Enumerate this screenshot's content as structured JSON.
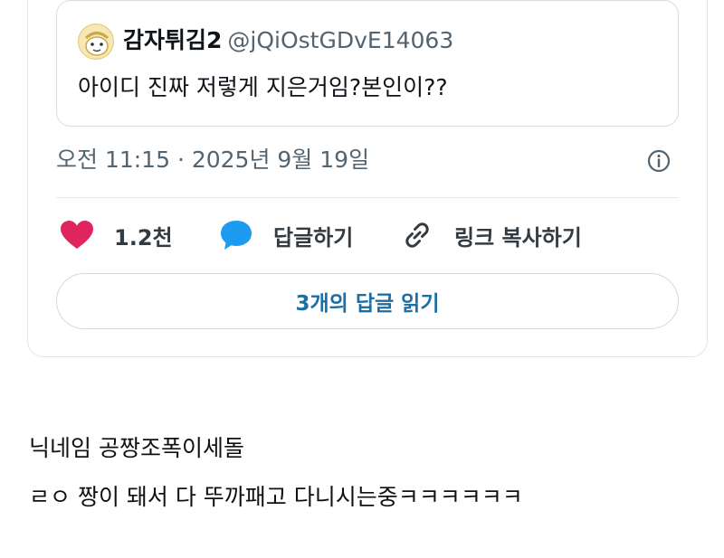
{
  "quoted_tweet": {
    "author_name": "감자튀김2",
    "author_handle": "@jQiOstGDvE14063",
    "text": "아이디 진짜 저렇게 지은거임?본인이??"
  },
  "tweet": {
    "timestamp": "오전 11:15 · 2025년 9월 19일"
  },
  "actions": {
    "like_count": "1.2천",
    "reply_label": "답글하기",
    "copy_link_label": "링크 복사하기"
  },
  "read_replies_label": "3개의 답글 읽기",
  "caption": {
    "line1": "닉네임 공짱조폭이세돌",
    "line2": "ㄹㅇ 짱이 돼서 다 뚜까패고 다니시는중ㅋㅋㅋㅋㅋㅋ"
  },
  "colors": {
    "like": "#e0245e",
    "reply": "#1d9bf0",
    "link_text": "#1d6fa3",
    "muted_text": "#536471"
  },
  "icons": [
    "avatar-image",
    "heart-icon",
    "speech-bubble-icon",
    "link-icon",
    "info-icon"
  ]
}
